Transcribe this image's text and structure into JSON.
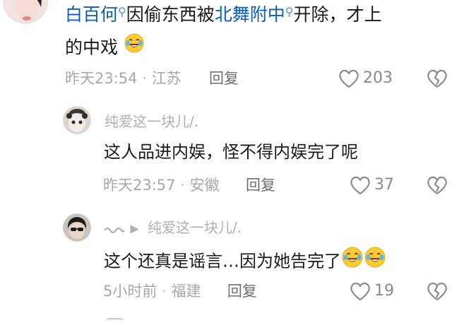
{
  "comment1": {
    "author": "白百何",
    "text_between_links": "因偷东西被",
    "school": "北舞附中",
    "text_after": "开除，才上",
    "line2": "的中戏",
    "emoji": "laughing-tears-emoji",
    "time": "昨天23:54",
    "dot": "·",
    "location": "江苏",
    "reply_label": "回复",
    "likes": "203"
  },
  "reply1": {
    "username": "纯爱这一块儿/.",
    "text": "这人品进内娱，怪不得内娱完了呢",
    "time": "昨天23:57",
    "dot": "·",
    "location": "安徽",
    "reply_label": "回复",
    "likes": "37"
  },
  "reply2": {
    "reply_to": "纯爱这一块儿/.",
    "text": "这个还真是谣言…因为她告完了",
    "emoji": "laughing-tears-emoji",
    "time": "5小时前",
    "dot": "·",
    "location": "福建",
    "reply_label": "回复",
    "likes": "19"
  },
  "colors": {
    "link": "#0a5fb4",
    "meta": "#a8a8a8",
    "text": "#1a1a1a"
  }
}
